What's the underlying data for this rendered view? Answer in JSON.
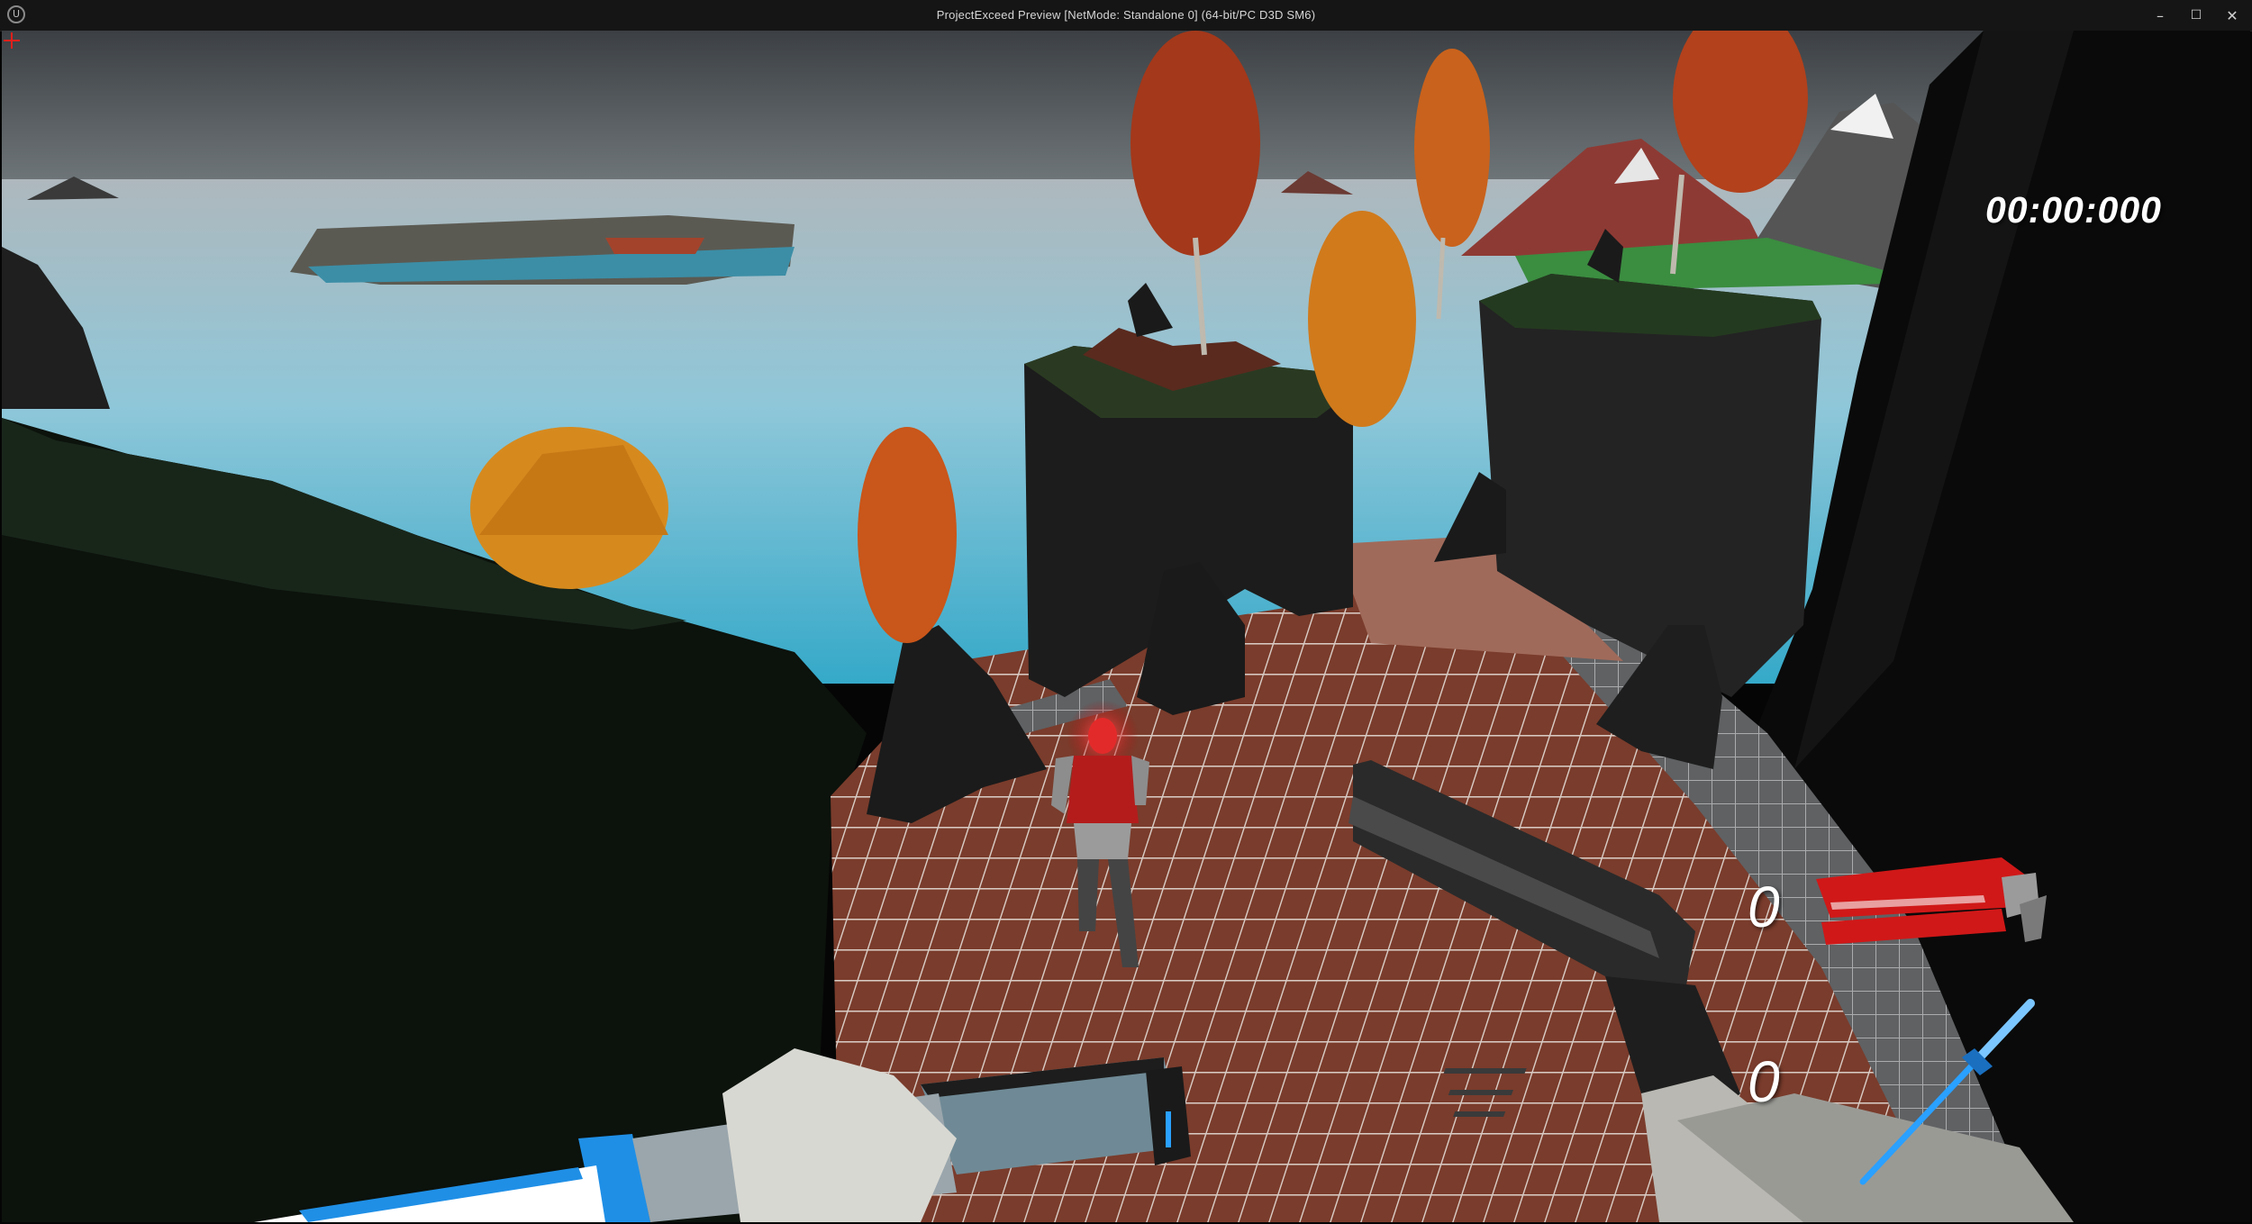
{
  "window": {
    "title": "ProjectExceed Preview [NetMode: Standalone 0]  (64-bit/PC D3D SM6)",
    "logo_text": "U",
    "controls": {
      "minimize": "–",
      "maximize": "☐",
      "close": "✕"
    }
  },
  "hud": {
    "timer": "00:00:000",
    "gun_ammo": "0",
    "sword_count": "0",
    "crosshair_color": "#e0201c",
    "gun_icon": "revolver-icon",
    "sword_icon": "katana-icon",
    "accent_red": "#d01818",
    "accent_blue": "#2aa0ff"
  }
}
